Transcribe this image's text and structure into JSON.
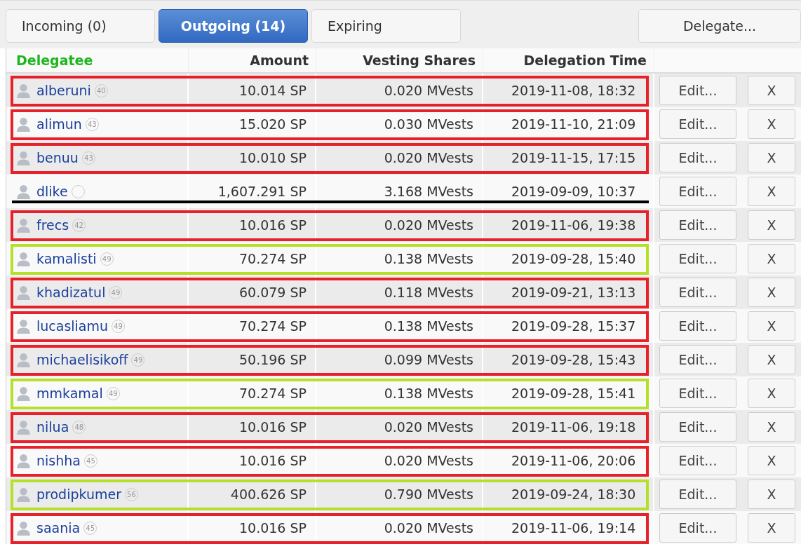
{
  "tabs": [
    {
      "label": "Incoming (0)",
      "selected": false
    },
    {
      "label": "Outgoing (14)",
      "selected": true
    },
    {
      "label": "Expiring",
      "selected": false
    }
  ],
  "delegate_button": "Delegate...",
  "columns": [
    "Delegatee",
    "Amount",
    "Vesting Shares",
    "Delegation Time"
  ],
  "rows": [
    {
      "name": "alberuni",
      "reputation": "40",
      "amount": "10.014 SP",
      "vests": "0.020 MVests",
      "time": "2019-11-08, 18:32",
      "edit": "Edit...",
      "remove": "X",
      "struck": false,
      "color": "#e8202a"
    },
    {
      "name": "alimun",
      "reputation": "43",
      "amount": "15.020 SP",
      "vests": "0.030 MVests",
      "time": "2019-11-10, 21:09",
      "edit": "Edit...",
      "remove": "X",
      "struck": false,
      "color": "#e8202a"
    },
    {
      "name": "benuu",
      "reputation": "43",
      "amount": "10.010 SP",
      "vests": "0.020 MVests",
      "time": "2019-11-15, 17:15",
      "edit": "Edit...",
      "remove": "X",
      "struck": false,
      "color": "#e8202a"
    },
    {
      "name": "dlike",
      "amount": "1,607.291 SP",
      "vests": "3.168 MVests",
      "time": "2019-09-09, 10:37",
      "edit": "Edit...",
      "remove": "X",
      "struck": true
    },
    {
      "name": "frecs",
      "reputation": "42",
      "amount": "10.016 SP",
      "vests": "0.020 MVests",
      "time": "2019-11-06, 19:38",
      "edit": "Edit...",
      "remove": "X",
      "struck": false,
      "color": "#e8202a"
    },
    {
      "name": "kamalisti",
      "reputation": "49",
      "amount": "70.274 SP",
      "vests": "0.138 MVests",
      "time": "2019-09-28, 15:40",
      "edit": "Edit...",
      "remove": "X",
      "struck": false,
      "color": "#b5e02a"
    },
    {
      "name": "khadizatul",
      "reputation": "49",
      "amount": "60.079 SP",
      "vests": "0.118 MVests",
      "time": "2019-09-21, 13:13",
      "edit": "Edit...",
      "remove": "X",
      "struck": false,
      "color": "#e8202a"
    },
    {
      "name": "lucasliamu",
      "reputation": "49",
      "amount": "70.274 SP",
      "vests": "0.138 MVests",
      "time": "2019-09-28, 15:37",
      "edit": "Edit...",
      "remove": "X",
      "struck": false,
      "color": "#e8202a"
    },
    {
      "name": "michaelisikoff",
      "reputation": "49",
      "amount": "50.196 SP",
      "vests": "0.099 MVests",
      "time": "2019-09-28, 15:43",
      "edit": "Edit...",
      "remove": "X",
      "struck": false,
      "color": "#e8202a"
    },
    {
      "name": "mmkamal",
      "reputation": "49",
      "amount": "70.274 SP",
      "vests": "0.138 MVests",
      "time": "2019-09-28, 15:41",
      "edit": "Edit...",
      "remove": "X",
      "struck": false,
      "color": "#b5e02a"
    },
    {
      "name": "nilua",
      "reputation": "48",
      "amount": "10.016 SP",
      "vests": "0.020 MVests",
      "time": "2019-11-06, 19:18",
      "edit": "Edit...",
      "remove": "X",
      "struck": false,
      "color": "#e8202a"
    },
    {
      "name": "nishha",
      "reputation": "45",
      "amount": "10.016 SP",
      "vests": "0.020 MVests",
      "time": "2019-11-06, 20:06",
      "edit": "Edit...",
      "remove": "X",
      "struck": false,
      "color": "#e8202a"
    },
    {
      "name": "prodipkumer",
      "reputation": "56",
      "amount": "400.626 SP",
      "vests": "0.790 MVests",
      "time": "2019-09-24, 18:30",
      "edit": "Edit...",
      "remove": "X",
      "struck": false,
      "color": "#b5e02a"
    },
    {
      "name": "saania",
      "reputation": "45",
      "amount": "10.016 SP",
      "vests": "0.020 MVests",
      "time": "2019-11-06, 19:14",
      "edit": "Edit...",
      "remove": "X",
      "struck": false,
      "color": "#e8202a"
    }
  ]
}
